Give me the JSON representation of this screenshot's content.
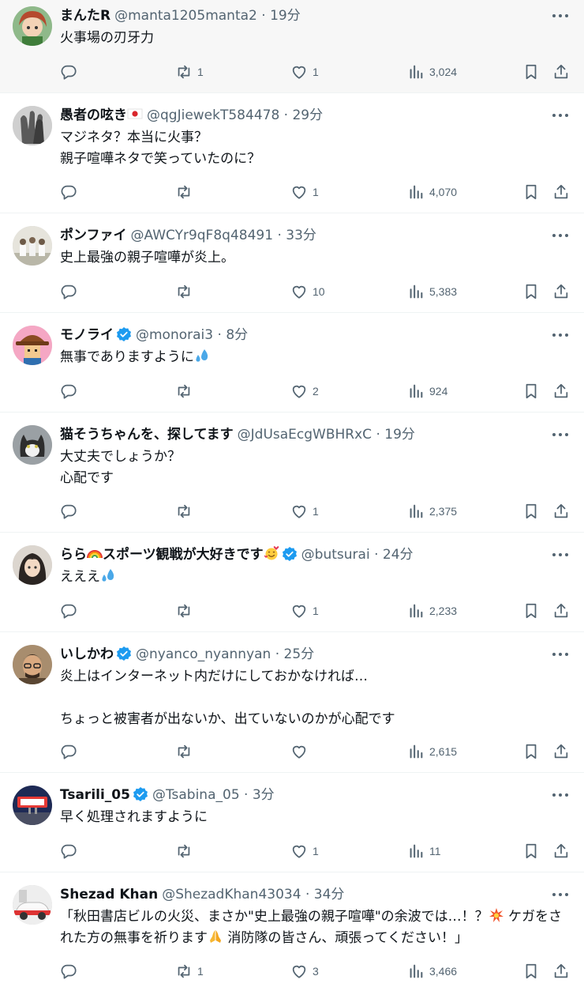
{
  "tweets": [
    {
      "name": "まんたR",
      "handle": "@manta1205manta2",
      "sep": "·",
      "time": "19分",
      "verified": false,
      "body": "火事場の刃牙力",
      "reply": "",
      "retweet": "1",
      "like": "1",
      "views": "3,024",
      "avatar": "avatar-anime-girl",
      "highlighted": true
    },
    {
      "name": "愚者の呟き",
      "flag": "japan-flag",
      "handle": "@qgJiewekT584478",
      "sep": "·",
      "time": "29分",
      "verified": false,
      "body": "マジネタ？本当に火事？\n親子喧嘩ネタで笑っていたのに？",
      "reply": "",
      "retweet": "",
      "like": "1",
      "views": "4,070",
      "avatar": "avatar-hands"
    },
    {
      "name": "ポンファイ",
      "handle": "@AWCYr9qF8q48491",
      "sep": "·",
      "time": "33分",
      "verified": false,
      "body": "史上最強の親子喧嘩が炎上。",
      "reply": "",
      "retweet": "",
      "like": "10",
      "views": "5,383",
      "avatar": "avatar-group"
    },
    {
      "name": "モノライ",
      "handle": "@monorai3",
      "sep": "·",
      "time": "8分",
      "verified": true,
      "body": "無事でありますように",
      "body_emoji": "sweat-drops-emoji",
      "reply": "",
      "retweet": "",
      "like": "2",
      "views": "924",
      "avatar": "avatar-cowboy"
    },
    {
      "name": "猫そうちゃんを、探してます",
      "handle": "@JdUsaEcgWBHRxC",
      "sep": "·",
      "time": "19分",
      "verified": false,
      "body": "大丈夫でしょうか？\n心配です",
      "reply": "",
      "retweet": "",
      "like": "1",
      "views": "2,375",
      "avatar": "avatar-cat"
    },
    {
      "name_a": "らら",
      "name_b": "スポーツ観戦が大好きです",
      "name_emoji_a": "rainbow-emoji",
      "name_emoji_b": "smiling-hearts-emoji",
      "handle": "@butsurai",
      "sep": "·",
      "time": "24分",
      "verified": true,
      "body": "えええ",
      "body_emoji": "sweat-drops-emoji",
      "reply": "",
      "retweet": "",
      "like": "1",
      "views": "2,233",
      "avatar": "avatar-anime-dark"
    },
    {
      "name": "いしかわ",
      "handle": "@nyanco_nyannyan",
      "sep": "·",
      "time": "25分",
      "verified": true,
      "body": "炎上はインターネット内だけにしておかなければ…\n\nちょっと被害者が出ないか、出ていないのかが心配です",
      "reply": "",
      "retweet": "",
      "like": "",
      "views": "2,615",
      "avatar": "avatar-man-glasses"
    },
    {
      "name": "Tsarili_05",
      "handle": "@Tsabina_05",
      "sep": "·",
      "time": "3分",
      "verified": true,
      "body": "早く処理されますように",
      "reply": "",
      "retweet": "",
      "like": "1",
      "views": "11",
      "avatar": "avatar-sign"
    },
    {
      "name": "Shezad Khan",
      "handle": "@ShezadKhan43034",
      "sep": "·",
      "time": "34分",
      "verified": false,
      "body_1": "「秋田書店ビルの火災、まさか\"史上最強の親子喧嘩\"の余波では…！？",
      "body_2": " ケガをされた方の無事を祈ります",
      "body_3": " 消防隊の皆さん、頑張ってください！」",
      "body_emoji_1": "collision-emoji",
      "body_emoji_2": "praying-hands-emoji",
      "reply": "",
      "retweet": "1",
      "like": "3",
      "views": "3,466",
      "avatar": "avatar-car"
    }
  ],
  "icons": {
    "reply": "reply-icon",
    "retweet": "retweet-icon",
    "like": "heart-icon",
    "views": "views-icon",
    "bookmark": "bookmark-icon",
    "share": "share-icon",
    "more": "more-icon",
    "verified": "verified-badge-icon"
  },
  "colors": {
    "verified": "#1d9bf0",
    "text": "#0f1419",
    "muted": "#536471",
    "divider": "#eff3f4"
  }
}
